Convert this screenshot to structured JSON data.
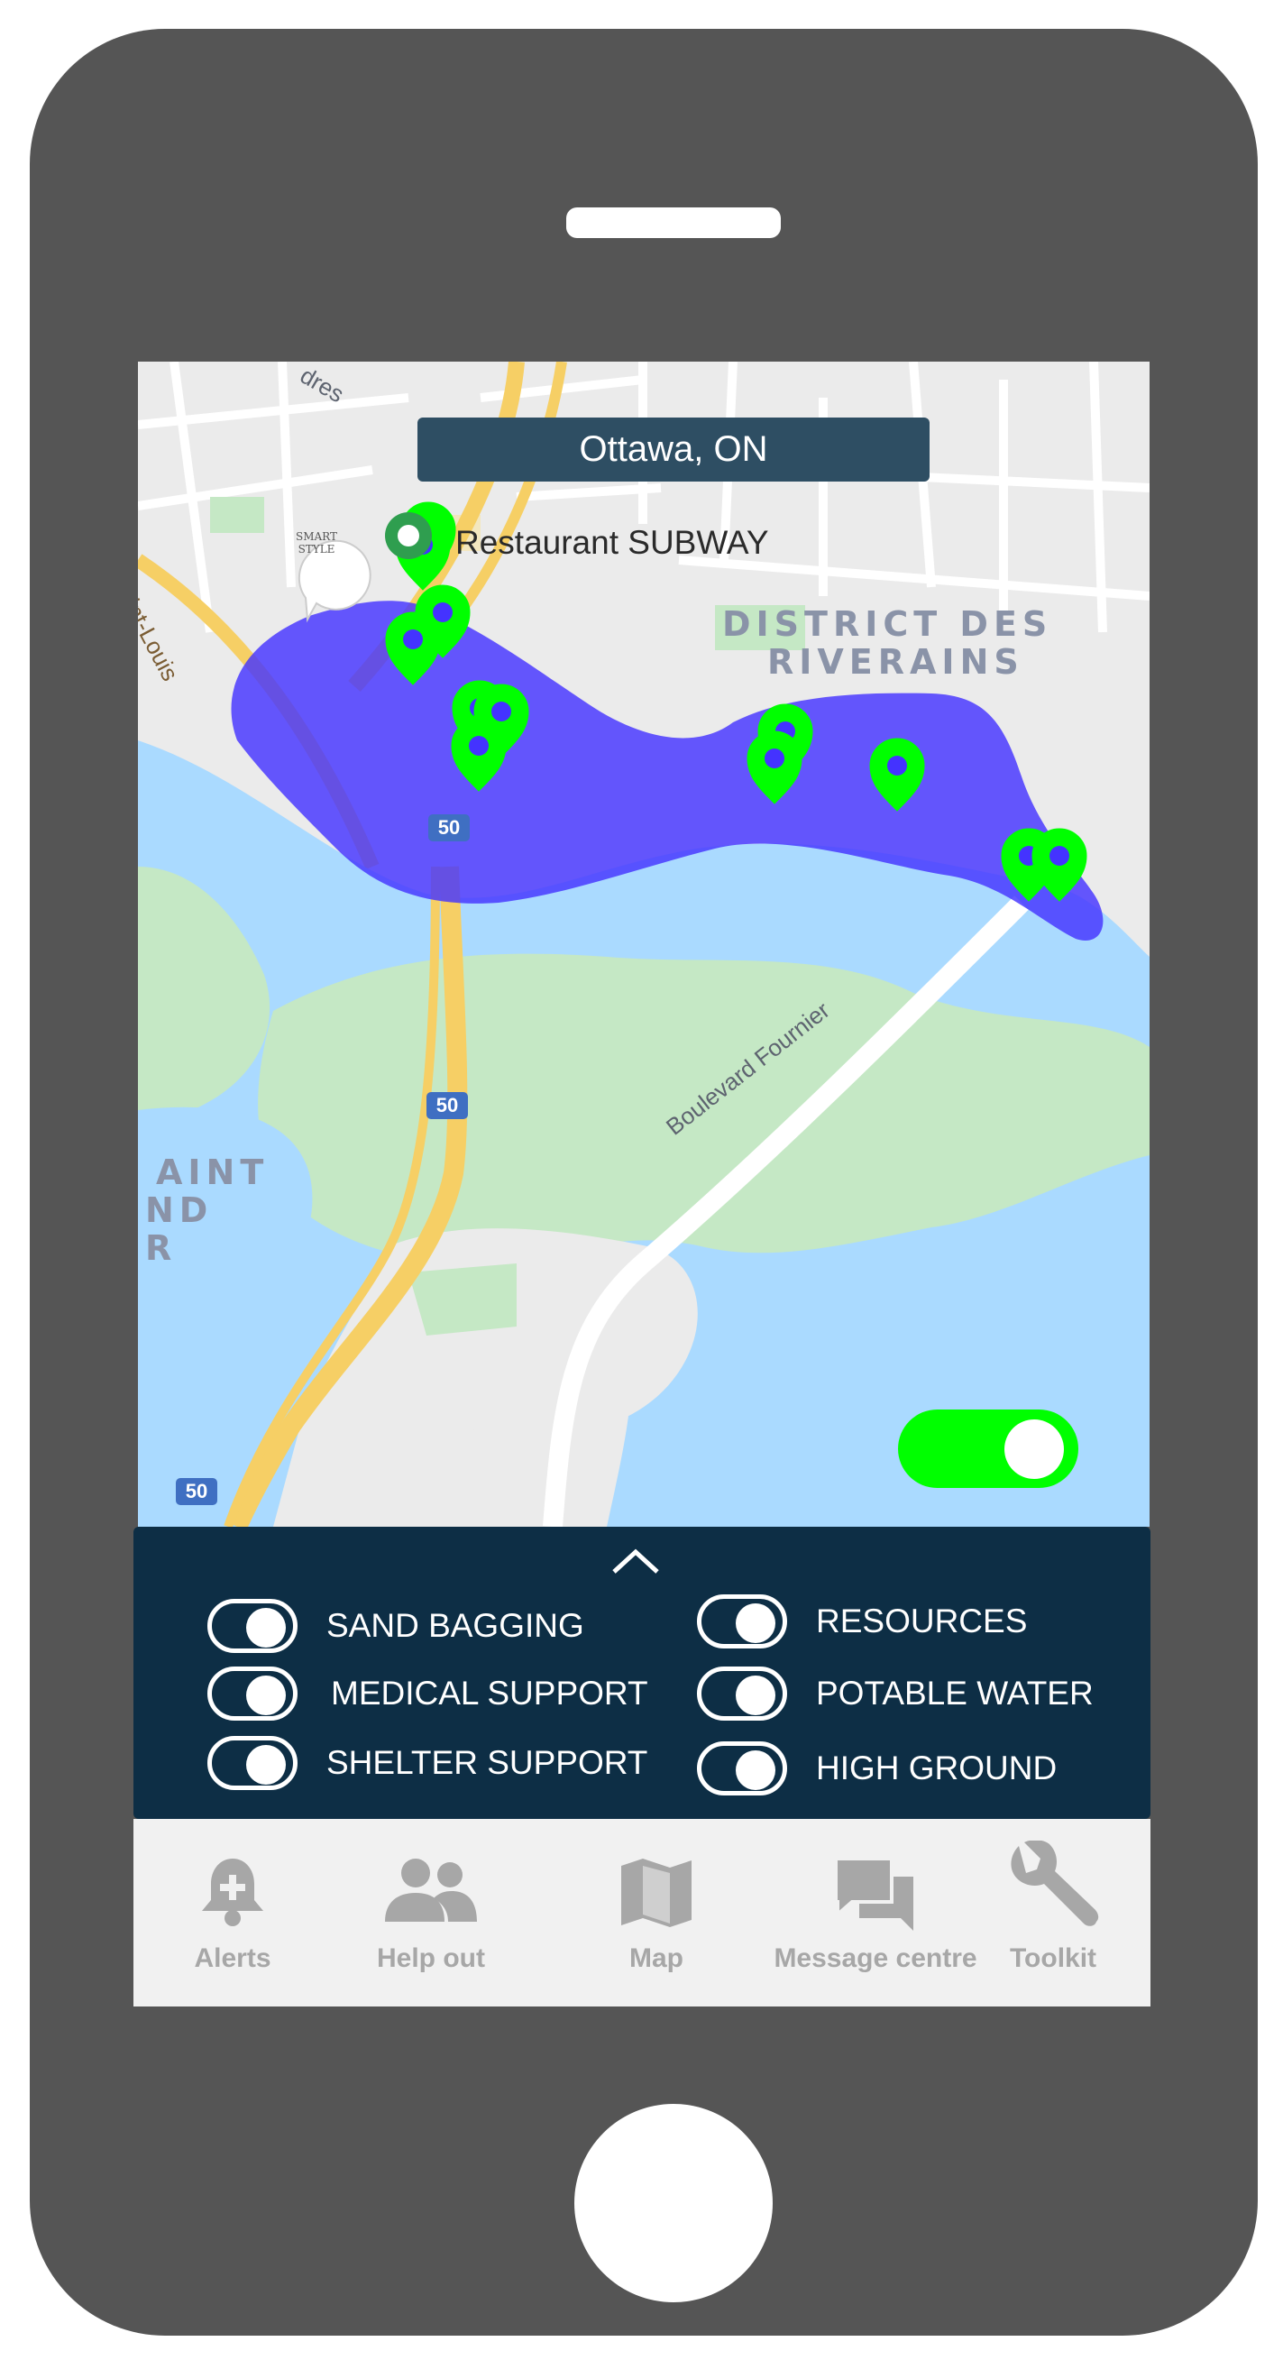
{
  "app": {
    "location": "Ottawa, ON"
  },
  "map": {
    "poi_label": "Restaurant SUBWAY",
    "district_line1": "DISTRICT DES",
    "district_line2": "RIVERAINS",
    "road_label": "Boulevard Fournier",
    "street_label_1": "Saint-Louis",
    "street_label_2": "dres",
    "area_label_1": "AINT",
    "area_label_2": "ND",
    "area_label_3": "R",
    "highway_shield": "50",
    "highway_shield_2": "50",
    "highway_shield_3": "50",
    "logo_text_1": "SMART",
    "logo_text_2": "STYLE",
    "marker_count": 12,
    "marker_color": "#00ff00",
    "flood_zone_color": "#4433ff",
    "toggle_on": true
  },
  "filters": {
    "items": [
      {
        "label": "SAND BAGGING",
        "on": true
      },
      {
        "label": "MEDICAL SUPPORT",
        "on": true
      },
      {
        "label": "SHELTER SUPPORT",
        "on": true
      },
      {
        "label": "RESOURCES",
        "on": true
      },
      {
        "label": "POTABLE WATER",
        "on": true
      },
      {
        "label": "HIGH GROUND",
        "on": true
      }
    ]
  },
  "tabs": [
    {
      "label": "Alerts",
      "icon": "bell-plus-icon"
    },
    {
      "label": "Help out",
      "icon": "people-icon"
    },
    {
      "label": "Map",
      "icon": "map-icon"
    },
    {
      "label": "Message centre",
      "icon": "chat-icon"
    },
    {
      "label": "Toolkit",
      "icon": "wrench-icon"
    }
  ],
  "colors": {
    "phone_body": "#555555",
    "header_bar": "#2e4e63",
    "panel": "#0d2e45",
    "tab_text": "#a7a7a7",
    "water": "#aadaff",
    "park": "#c5e8c5"
  }
}
